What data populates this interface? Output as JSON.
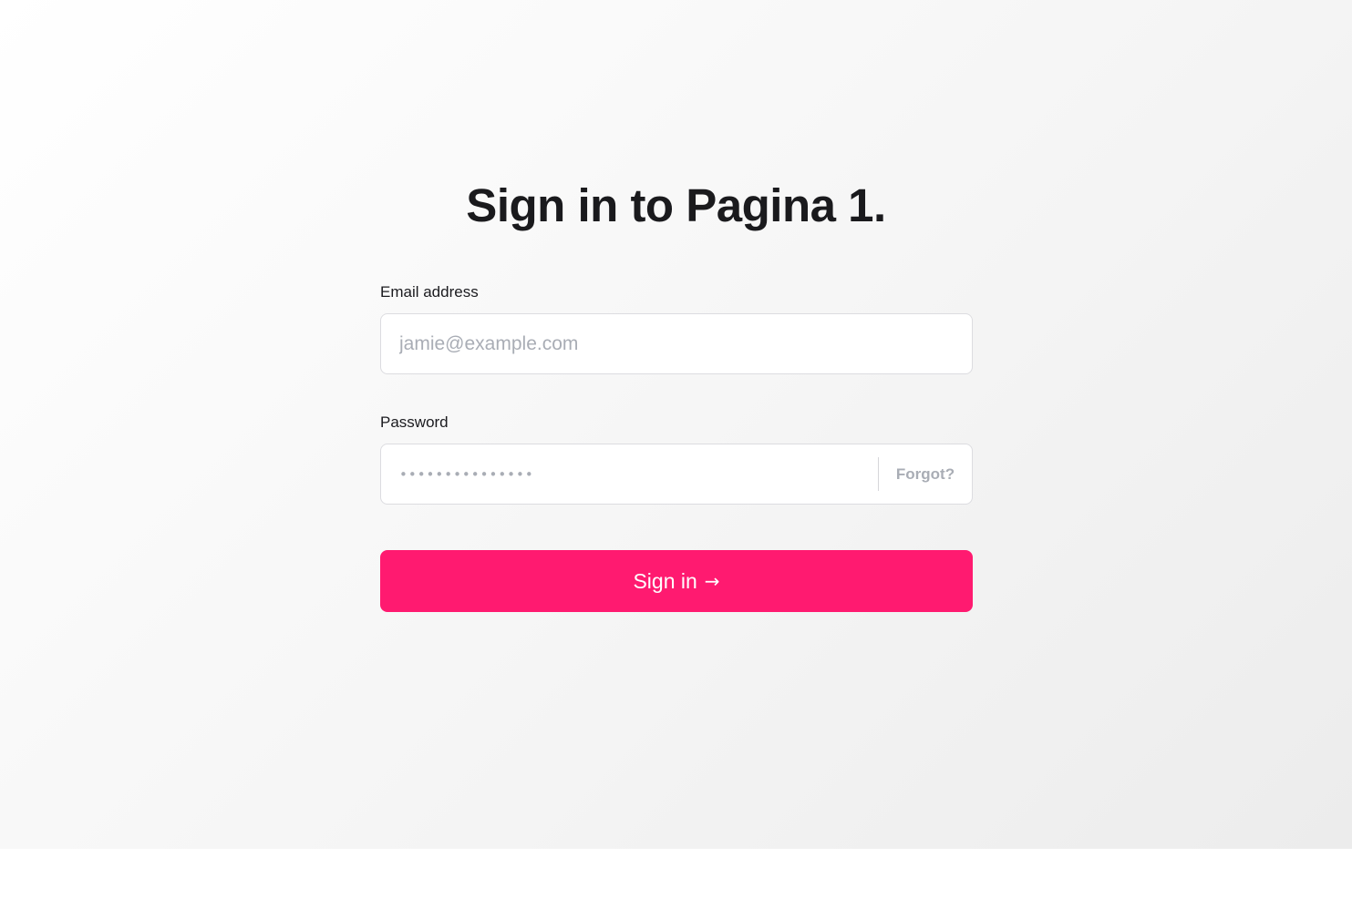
{
  "page": {
    "title": "Sign in to Pagina 1."
  },
  "form": {
    "email": {
      "label": "Email address",
      "placeholder": "jamie@example.com"
    },
    "password": {
      "label": "Password",
      "masked_value": "•••••••••••••••",
      "forgot_label": "Forgot?"
    },
    "submit": {
      "label": "Sign in",
      "icon": "arrow-right-icon",
      "icon_glyph": "→"
    }
  },
  "colors": {
    "accent": "#ff1a70",
    "heading": "#1a1a1d",
    "placeholder": "#a9adb5"
  }
}
